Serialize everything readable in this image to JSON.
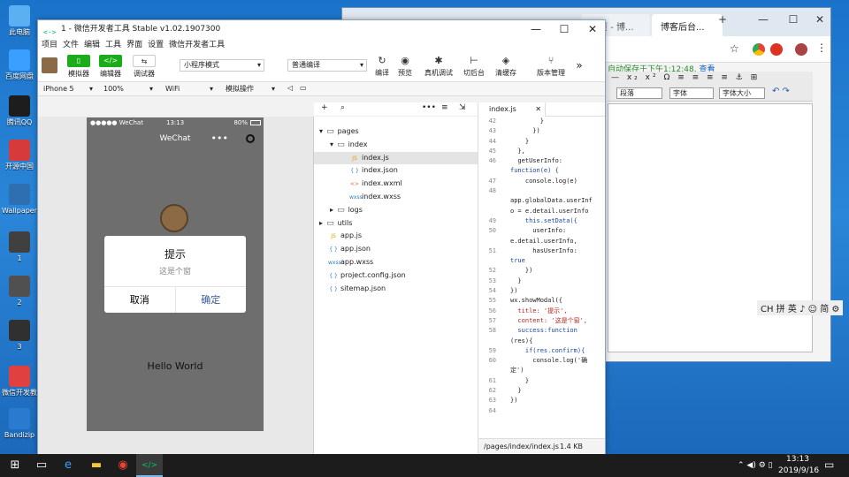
{
  "desktop": {
    "icons": [
      {
        "label": "此电脑",
        "color": "#5ab0f0"
      },
      {
        "label": "百度网盘",
        "color": "#3aa0ff"
      },
      {
        "label": "腾讯QQ",
        "color": "#1d1d1d"
      },
      {
        "label": "开源中国",
        "color": "#d63a3a"
      },
      {
        "label": "Wallpaper Engine",
        "color": "#2d6fb0"
      },
      {
        "label": "1",
        "color": "#404040"
      },
      {
        "label": "2",
        "color": "#505050"
      },
      {
        "label": "3",
        "color": "#303030"
      },
      {
        "label": "微信开发教程分析 - 副本",
        "color": "#e04040"
      },
      {
        "label": "Bandizip",
        "color": "#2a7ad0"
      }
    ]
  },
  "browser": {
    "tabs": [
      "首页 - 博...",
      "博客后台..."
    ],
    "autosave_text": "自动保存于下午1:12:48,",
    "autosave_link": "查看",
    "paragraph_select": "段落",
    "font_select": "字体",
    "size_select": "字体大小",
    "ime_text": "CH 拼 英 ♪ ☺ 简 ⚙"
  },
  "devtools": {
    "title": "1 - 微信开发者工具 Stable v1.02.1907300",
    "logo": "<·>",
    "menu": [
      "项目",
      "文件",
      "编辑",
      "工具",
      "界面",
      "设置",
      "微信开发者工具"
    ],
    "toolbar": {
      "simulator": "模拟器",
      "editor": "编辑器",
      "debugger": "调试器",
      "mode_select": "小程序模式",
      "compile_select": "普通编译",
      "compile": "编译",
      "preview": "预览",
      "remote_debug": "真机调试",
      "cut_back": "切后台",
      "clear_cache": "清缓存",
      "version": "版本管理"
    },
    "subbar": {
      "device": "iPhone 5",
      "zoom": "100%",
      "network": "WiFi",
      "operation": "模拟操作"
    }
  },
  "phone": {
    "carrier": "●●●●● WeChat",
    "time": "13:13",
    "battery": "80%",
    "nav_title": "WeChat",
    "hello": "Hello World",
    "modal": {
      "title": "提示",
      "content": "这是个窗",
      "cancel": "取消",
      "confirm": "确定"
    }
  },
  "file_tree": [
    {
      "name": "pages",
      "type": "folder",
      "depth": 0,
      "open": true
    },
    {
      "name": "index",
      "type": "folder",
      "depth": 1,
      "open": true
    },
    {
      "name": "index.js",
      "type": "js",
      "depth": 2,
      "selected": true
    },
    {
      "name": "index.json",
      "type": "json",
      "depth": 2
    },
    {
      "name": "index.wxml",
      "type": "wxml",
      "depth": 2
    },
    {
      "name": "index.wxss",
      "type": "wxss",
      "depth": 2
    },
    {
      "name": "logs",
      "type": "folder",
      "depth": 1,
      "open": false
    },
    {
      "name": "utils",
      "type": "folder",
      "depth": 0,
      "open": false
    },
    {
      "name": "app.js",
      "type": "js",
      "depth": 0
    },
    {
      "name": "app.json",
      "type": "json",
      "depth": 0
    },
    {
      "name": "app.wxss",
      "type": "wxss",
      "depth": 0
    },
    {
      "name": "project.config.json",
      "type": "json",
      "depth": 0
    },
    {
      "name": "sitemap.json",
      "type": "json",
      "depth": 0
    }
  ],
  "editor": {
    "tab": "index.js",
    "lines": [
      {
        "n": "42",
        "t": "        }"
      },
      {
        "n": "43",
        "t": "      })"
      },
      {
        "n": "44",
        "t": "    }"
      },
      {
        "n": "45",
        "t": "  },"
      },
      {
        "n": "46",
        "t": "  getUserInfo:"
      },
      {
        "n": "",
        "t": "function(e) {"
      },
      {
        "n": "47",
        "t": "    console.log(e)"
      },
      {
        "n": "48",
        "t": ""
      },
      {
        "n": "",
        "t": "app.globalData.userInf"
      },
      {
        "n": "",
        "t": "o = e.detail.userInfo"
      },
      {
        "n": "49",
        "t": "    this.setData({"
      },
      {
        "n": "50",
        "t": "      userInfo:"
      },
      {
        "n": "",
        "t": "e.detail.userInfo,"
      },
      {
        "n": "51",
        "t": "      hasUserInfo:"
      },
      {
        "n": "",
        "t": "true"
      },
      {
        "n": "52",
        "t": "    })"
      },
      {
        "n": "53",
        "t": "  }"
      },
      {
        "n": "54",
        "t": "})"
      },
      {
        "n": "55",
        "t": "wx.showModal({"
      },
      {
        "n": "56",
        "t": "  title: '提示',"
      },
      {
        "n": "57",
        "t": "  content: '这是个窗',"
      },
      {
        "n": "58",
        "t": "  success:function"
      },
      {
        "n": "",
        "t": "(res){"
      },
      {
        "n": "59",
        "t": "    if(res.confirm){"
      },
      {
        "n": "60",
        "t": "      console.log('确"
      },
      {
        "n": "",
        "t": "定')"
      },
      {
        "n": "61",
        "t": "    }"
      },
      {
        "n": "62",
        "t": "  }"
      },
      {
        "n": "63",
        "t": "})"
      },
      {
        "n": "64",
        "t": ""
      }
    ],
    "path": "/pages/index/index.js",
    "size": "1.4 KB"
  },
  "taskbar": {
    "time": "13:13",
    "date": "2019/9/16"
  }
}
